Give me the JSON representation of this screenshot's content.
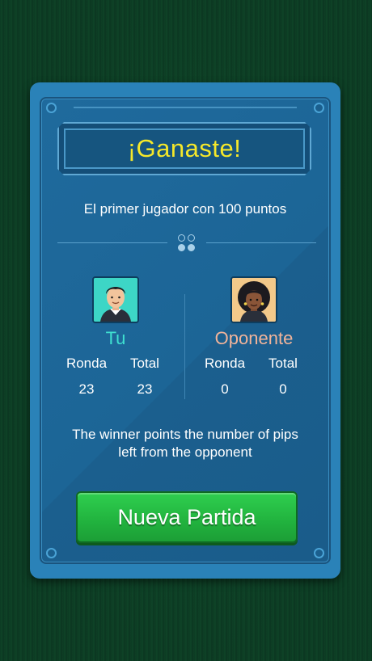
{
  "dialog": {
    "title": "¡Ganaste!",
    "subtitle": "El primer jugador con 100 puntos",
    "description_line1": "The winner points the number of pips",
    "description_line2": "left from the opponent",
    "button_label": "Nueva Partida"
  },
  "players": [
    {
      "name": "Tu",
      "color": "#3fe0d0",
      "round_label": "Ronda",
      "total_label": "Total",
      "round": "23",
      "total": "23"
    },
    {
      "name": "Oponente",
      "color": "#f2b49a",
      "round_label": "Ronda",
      "total_label": "Total",
      "round": "0",
      "total": "0"
    }
  ],
  "colors": {
    "title": "#f5e82a",
    "button": "#21b23e",
    "panel": "#2a82b8"
  },
  "icons": [
    "male-avatar-icon",
    "female-avatar-icon",
    "dots-icon"
  ]
}
